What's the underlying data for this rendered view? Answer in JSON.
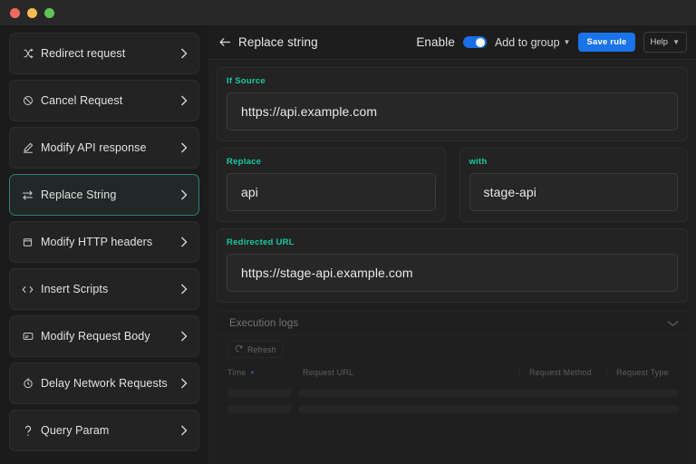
{
  "window": {
    "traffic_lights": [
      "close",
      "minimize",
      "maximize"
    ],
    "colors": {
      "close": "#ee6a5f",
      "minimize": "#f5bd4f",
      "maximize": "#61c454",
      "accent_label": "#17c9a0",
      "accent_button": "#1a73e8",
      "selected_border": "#2f7f75"
    }
  },
  "sidebar": {
    "items": [
      {
        "label": "Redirect request",
        "icon": "shuffle-icon",
        "selected": false
      },
      {
        "label": "Cancel Request",
        "icon": "block-icon",
        "selected": false
      },
      {
        "label": "Modify API response",
        "icon": "pencil-icon",
        "selected": false
      },
      {
        "label": "Replace String",
        "icon": "swap-arrows-icon",
        "selected": true
      },
      {
        "label": "Modify HTTP headers",
        "icon": "window-icon",
        "selected": false
      },
      {
        "label": "Insert Scripts",
        "icon": "code-brackets-icon",
        "selected": false
      },
      {
        "label": "Modify Request Body",
        "icon": "form-card-icon",
        "selected": false
      },
      {
        "label": "Delay Network Requests",
        "icon": "clock-icon",
        "selected": false
      },
      {
        "label": "Query Param",
        "icon": "question-mark-icon",
        "selected": false
      }
    ]
  },
  "topbar": {
    "back_icon": "arrow-left-icon",
    "title": "Replace string",
    "enable_label": "Enable",
    "enable_on": true,
    "add_to_group_label": "Add to group",
    "save_label": "Save rule",
    "help_label": "Help"
  },
  "form": {
    "if_source": {
      "label": "If Source",
      "value": "https://api.example.com",
      "placeholder": "https://api.example.com"
    },
    "replace": {
      "label": "Replace",
      "value": "api",
      "placeholder": "api"
    },
    "with": {
      "label": "with",
      "value": "stage-api",
      "placeholder": "stage-api"
    },
    "redirected_url": {
      "label": "Redirected URL",
      "value": "https://stage-api.example.com",
      "placeholder": "https://stage-api.example.com"
    }
  },
  "logs": {
    "title": "Execution logs",
    "collapse_icon": "chevron-down-icon",
    "refresh_label": "Refresh",
    "refresh_icon": "refresh-icon",
    "columns": [
      "Time",
      "Request URL",
      "Request Method",
      "Request Type"
    ],
    "sort_column": "Time",
    "sort_direction": "desc",
    "rows": []
  }
}
